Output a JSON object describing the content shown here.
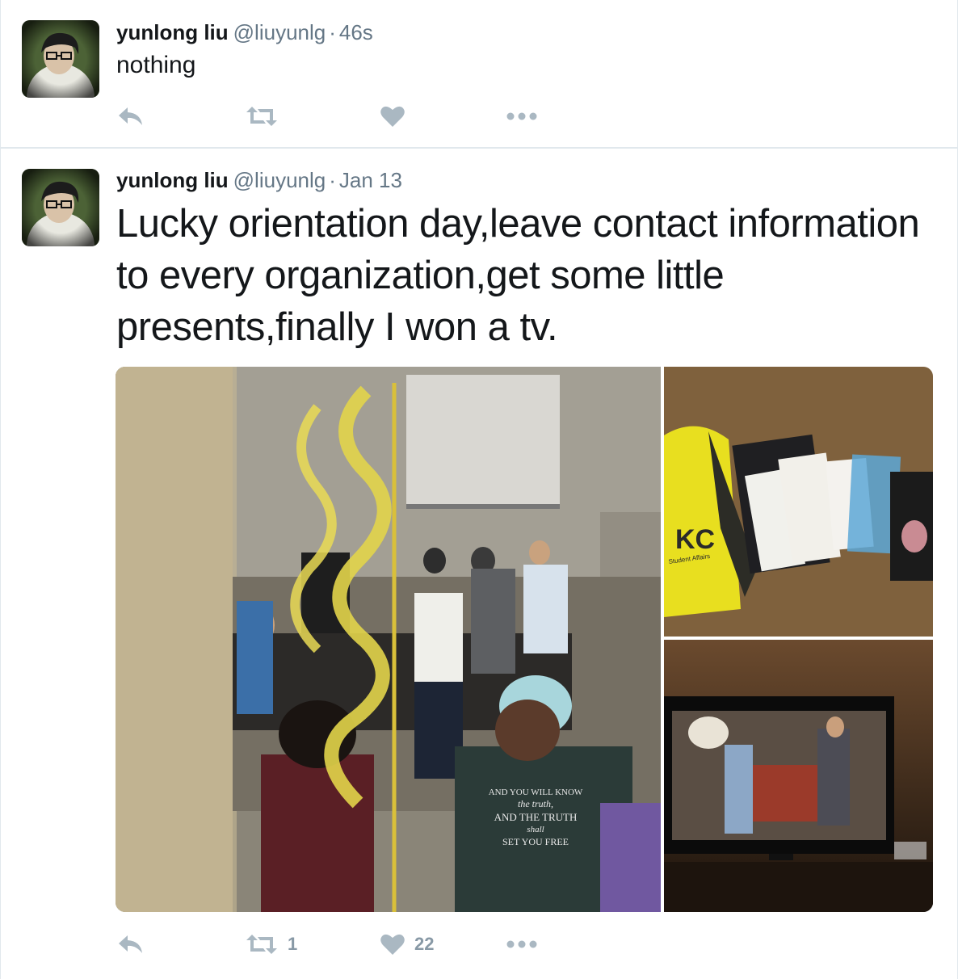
{
  "tweets": [
    {
      "fullname": "yunlong liu",
      "screenname": "@liuyunlg",
      "separator": "·",
      "timestamp": "46s",
      "text": "nothing",
      "retweet_count": "",
      "like_count": ""
    },
    {
      "fullname": "yunlong liu",
      "screenname": "@liuyunlg",
      "separator": "·",
      "timestamp": "Jan 13",
      "text": "Lucky orientation day,leave contact information to every organization,get some little presents,finally I won a tv.",
      "retweet_count": "1",
      "like_count": "22",
      "media_text": {
        "bag_logo": "KC",
        "bag_caption": "Student Affairs",
        "shirt_line_1": "AND YOU WILL KNOW",
        "shirt_line_2": "the truth,",
        "shirt_line_3": "AND THE TRUTH",
        "shirt_line_4": "shall",
        "shirt_line_5": "SET YOU FREE"
      }
    }
  ],
  "colors": {
    "text": "#14171a",
    "secondary": "#657786",
    "action_icon": "#aab8c2",
    "divider": "#e1e8ed"
  },
  "icons": [
    "reply-icon",
    "retweet-icon",
    "like-icon",
    "more-icon"
  ]
}
